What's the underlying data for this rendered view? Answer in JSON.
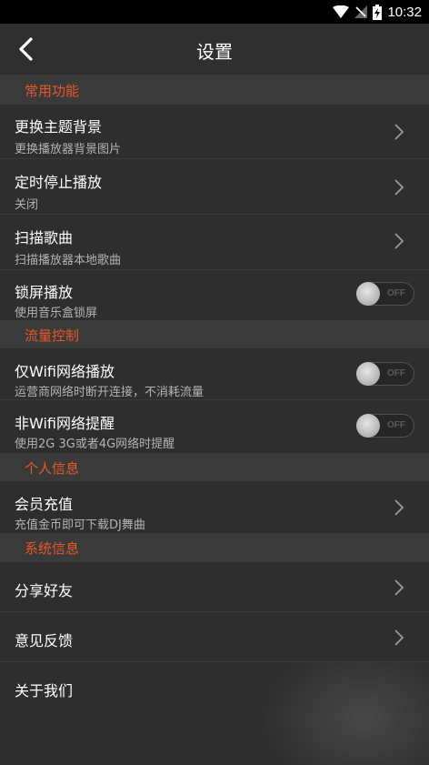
{
  "status_bar": {
    "time": "10:32",
    "icons": [
      "wifi-icon",
      "no-signal-icon",
      "battery-charging-icon"
    ]
  },
  "header": {
    "title": "设置",
    "back_icon": "back-arrow-icon"
  },
  "colors": {
    "accent": "#e8562a",
    "background": "#2e2e2e",
    "section_background": "#3a3a3a"
  },
  "sections": {
    "common": {
      "title": "常用功能",
      "items": [
        {
          "label": "更换主题背景",
          "sub": "更换播放器背景图片",
          "control": "chevron"
        },
        {
          "label": "定时停止播放",
          "sub": "关闭",
          "control": "chevron"
        },
        {
          "label": "扫描歌曲",
          "sub": "扫描播放器本地歌曲",
          "control": "chevron"
        },
        {
          "label": "锁屏播放",
          "sub": "使用音乐盒锁屏",
          "control": "toggle",
          "toggle_text": "OFF",
          "on": false
        }
      ]
    },
    "traffic": {
      "title": "流量控制",
      "items": [
        {
          "label": "仅Wifi网络播放",
          "sub": "运营商网络时断开连接，不消耗流量",
          "control": "toggle",
          "toggle_text": "OFF",
          "on": false
        },
        {
          "label": "非Wifi网络提醒",
          "sub": "使用2G  3G或者4G网络时提醒",
          "control": "toggle",
          "toggle_text": "OFF",
          "on": false
        }
      ]
    },
    "personal": {
      "title": "个人信息",
      "items": [
        {
          "label": "会员充值",
          "sub": "充值金币即可下载DJ舞曲",
          "control": "chevron"
        }
      ]
    },
    "system": {
      "title": "系统信息",
      "items": [
        {
          "label": "分享好友",
          "control": "chevron"
        },
        {
          "label": "意见反馈",
          "control": "chevron"
        },
        {
          "label": "关于我们",
          "control": "none"
        }
      ]
    }
  }
}
